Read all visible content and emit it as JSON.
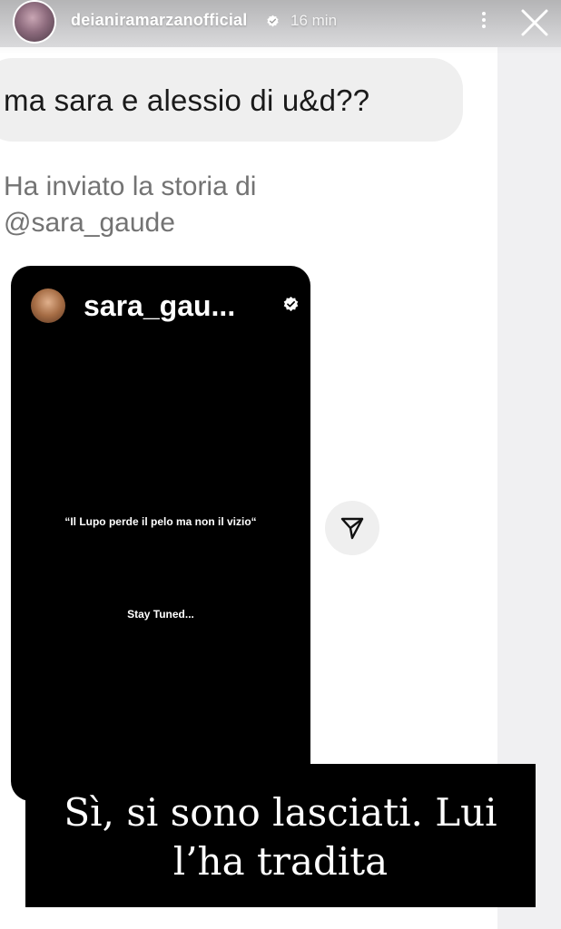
{
  "header": {
    "username": "deianiramarzanofficial",
    "time": "16 min",
    "avatar_icon": "profile-avatar",
    "verified_icon": "verified-badge-icon",
    "more_icon": "more-vertical-icon",
    "close_icon": "close-icon"
  },
  "dm": {
    "message": "ma sara e alessio di u&d??",
    "story_share_note": "Ha inviato la storia di @sara_gaude"
  },
  "shared_story": {
    "username": "sara_gau...",
    "quote": "“Il Lupo perde il pelo ma non il vizio“",
    "stay_tuned": "Stay Tuned...",
    "share_icon": "send-icon"
  },
  "caption": {
    "text": "Sì, si sono lasciati. Lui l’ha tradita"
  },
  "colors": {
    "bubble": "#efefef",
    "card": "#000000",
    "caption_bg": "#000000",
    "note_text": "#737373"
  }
}
